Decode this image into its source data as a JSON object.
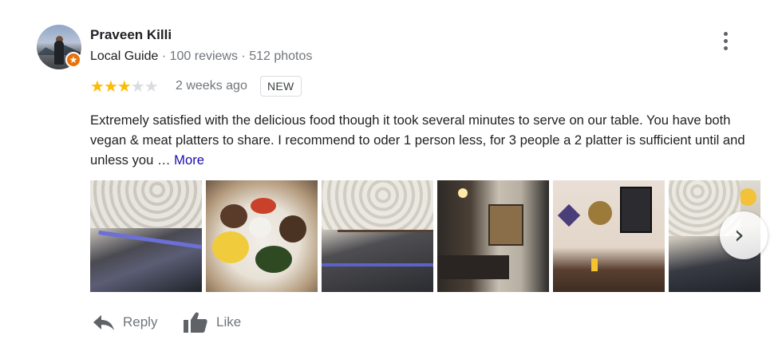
{
  "reviewer": {
    "name": "Praveen Killi",
    "role": "Local Guide",
    "reviews": "100 reviews",
    "photos": "512 photos",
    "separator": " · "
  },
  "rating": {
    "stars": 3,
    "max": 5
  },
  "time_ago": "2 weeks ago",
  "badge": "NEW",
  "review": {
    "text": "Extremely satisfied with the delicious food though it took several minutes to serve on our table. You have both vegan & meat platters to share. I recommend to oder 1 person less, for 3 people a 2 platter is sufficient until and unless you …",
    "more_label": "More"
  },
  "photos": {
    "count_visible": 6
  },
  "actions": {
    "reply_label": "Reply",
    "like_label": "Like"
  },
  "icons": {
    "menu": "more-vert-icon",
    "next": "chevron-right-icon",
    "reply": "reply-icon",
    "like": "thumb-up-icon",
    "guide": "local-guide-star-icon"
  },
  "colors": {
    "star": "#fbbc04",
    "link": "#1a0dab",
    "guide_badge": "#e8710a",
    "muted": "#70757a"
  }
}
